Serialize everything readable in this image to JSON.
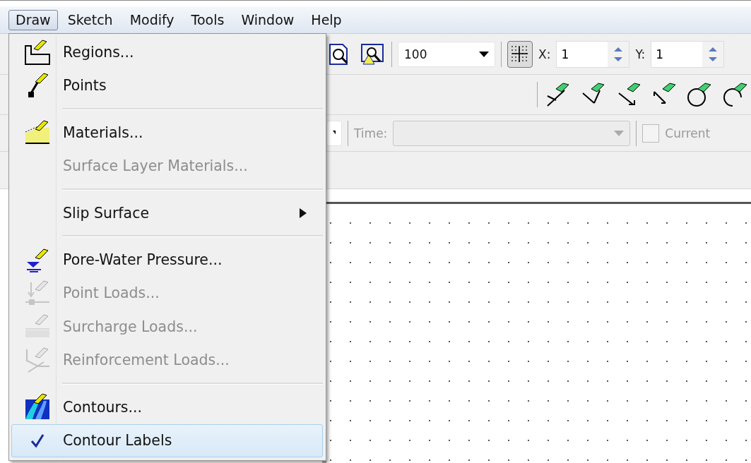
{
  "menu_bar": [
    {
      "label": "Draw",
      "selected": true
    },
    {
      "label": "Sketch",
      "selected": false
    },
    {
      "label": "Modify",
      "selected": false
    },
    {
      "label": "Tools",
      "selected": false
    },
    {
      "label": "Window",
      "selected": false
    },
    {
      "label": "Help",
      "selected": false
    }
  ],
  "toolbar": {
    "zoom": "100",
    "x_label": "X:",
    "x_value": "1",
    "y_label": "Y:",
    "y_value": "1",
    "grid_on": true,
    "time_label": "Time:",
    "time_disabled": true,
    "current_label": "Current",
    "current_checked": false
  },
  "draw_menu": [
    {
      "kind": "item",
      "label": "Regions...",
      "disabled": false,
      "checked": false,
      "submenu": false,
      "selected": false
    },
    {
      "kind": "item",
      "label": "Points",
      "disabled": false,
      "checked": false,
      "submenu": false,
      "selected": false
    },
    {
      "kind": "separator"
    },
    {
      "kind": "item",
      "label": "Materials...",
      "disabled": false,
      "checked": false,
      "submenu": false,
      "selected": false
    },
    {
      "kind": "item",
      "label": "Surface Layer Materials...",
      "disabled": true,
      "checked": false,
      "submenu": false,
      "selected": false
    },
    {
      "kind": "separator"
    },
    {
      "kind": "item",
      "label": "Slip Surface",
      "disabled": false,
      "checked": false,
      "submenu": true,
      "selected": false
    },
    {
      "kind": "separator"
    },
    {
      "kind": "item",
      "label": "Pore-Water Pressure...",
      "disabled": false,
      "checked": false,
      "submenu": false,
      "selected": false
    },
    {
      "kind": "item",
      "label": "Point Loads...",
      "disabled": true,
      "checked": false,
      "submenu": false,
      "selected": false
    },
    {
      "kind": "item",
      "label": "Surcharge Loads...",
      "disabled": true,
      "checked": false,
      "submenu": false,
      "selected": false
    },
    {
      "kind": "item",
      "label": "Reinforcement Loads...",
      "disabled": true,
      "checked": false,
      "submenu": false,
      "selected": false
    },
    {
      "kind": "separator"
    },
    {
      "kind": "item",
      "label": "Contours...",
      "disabled": false,
      "checked": false,
      "submenu": false,
      "selected": false
    },
    {
      "kind": "item",
      "label": "Contour Labels",
      "disabled": false,
      "checked": true,
      "submenu": false,
      "selected": true
    }
  ]
}
